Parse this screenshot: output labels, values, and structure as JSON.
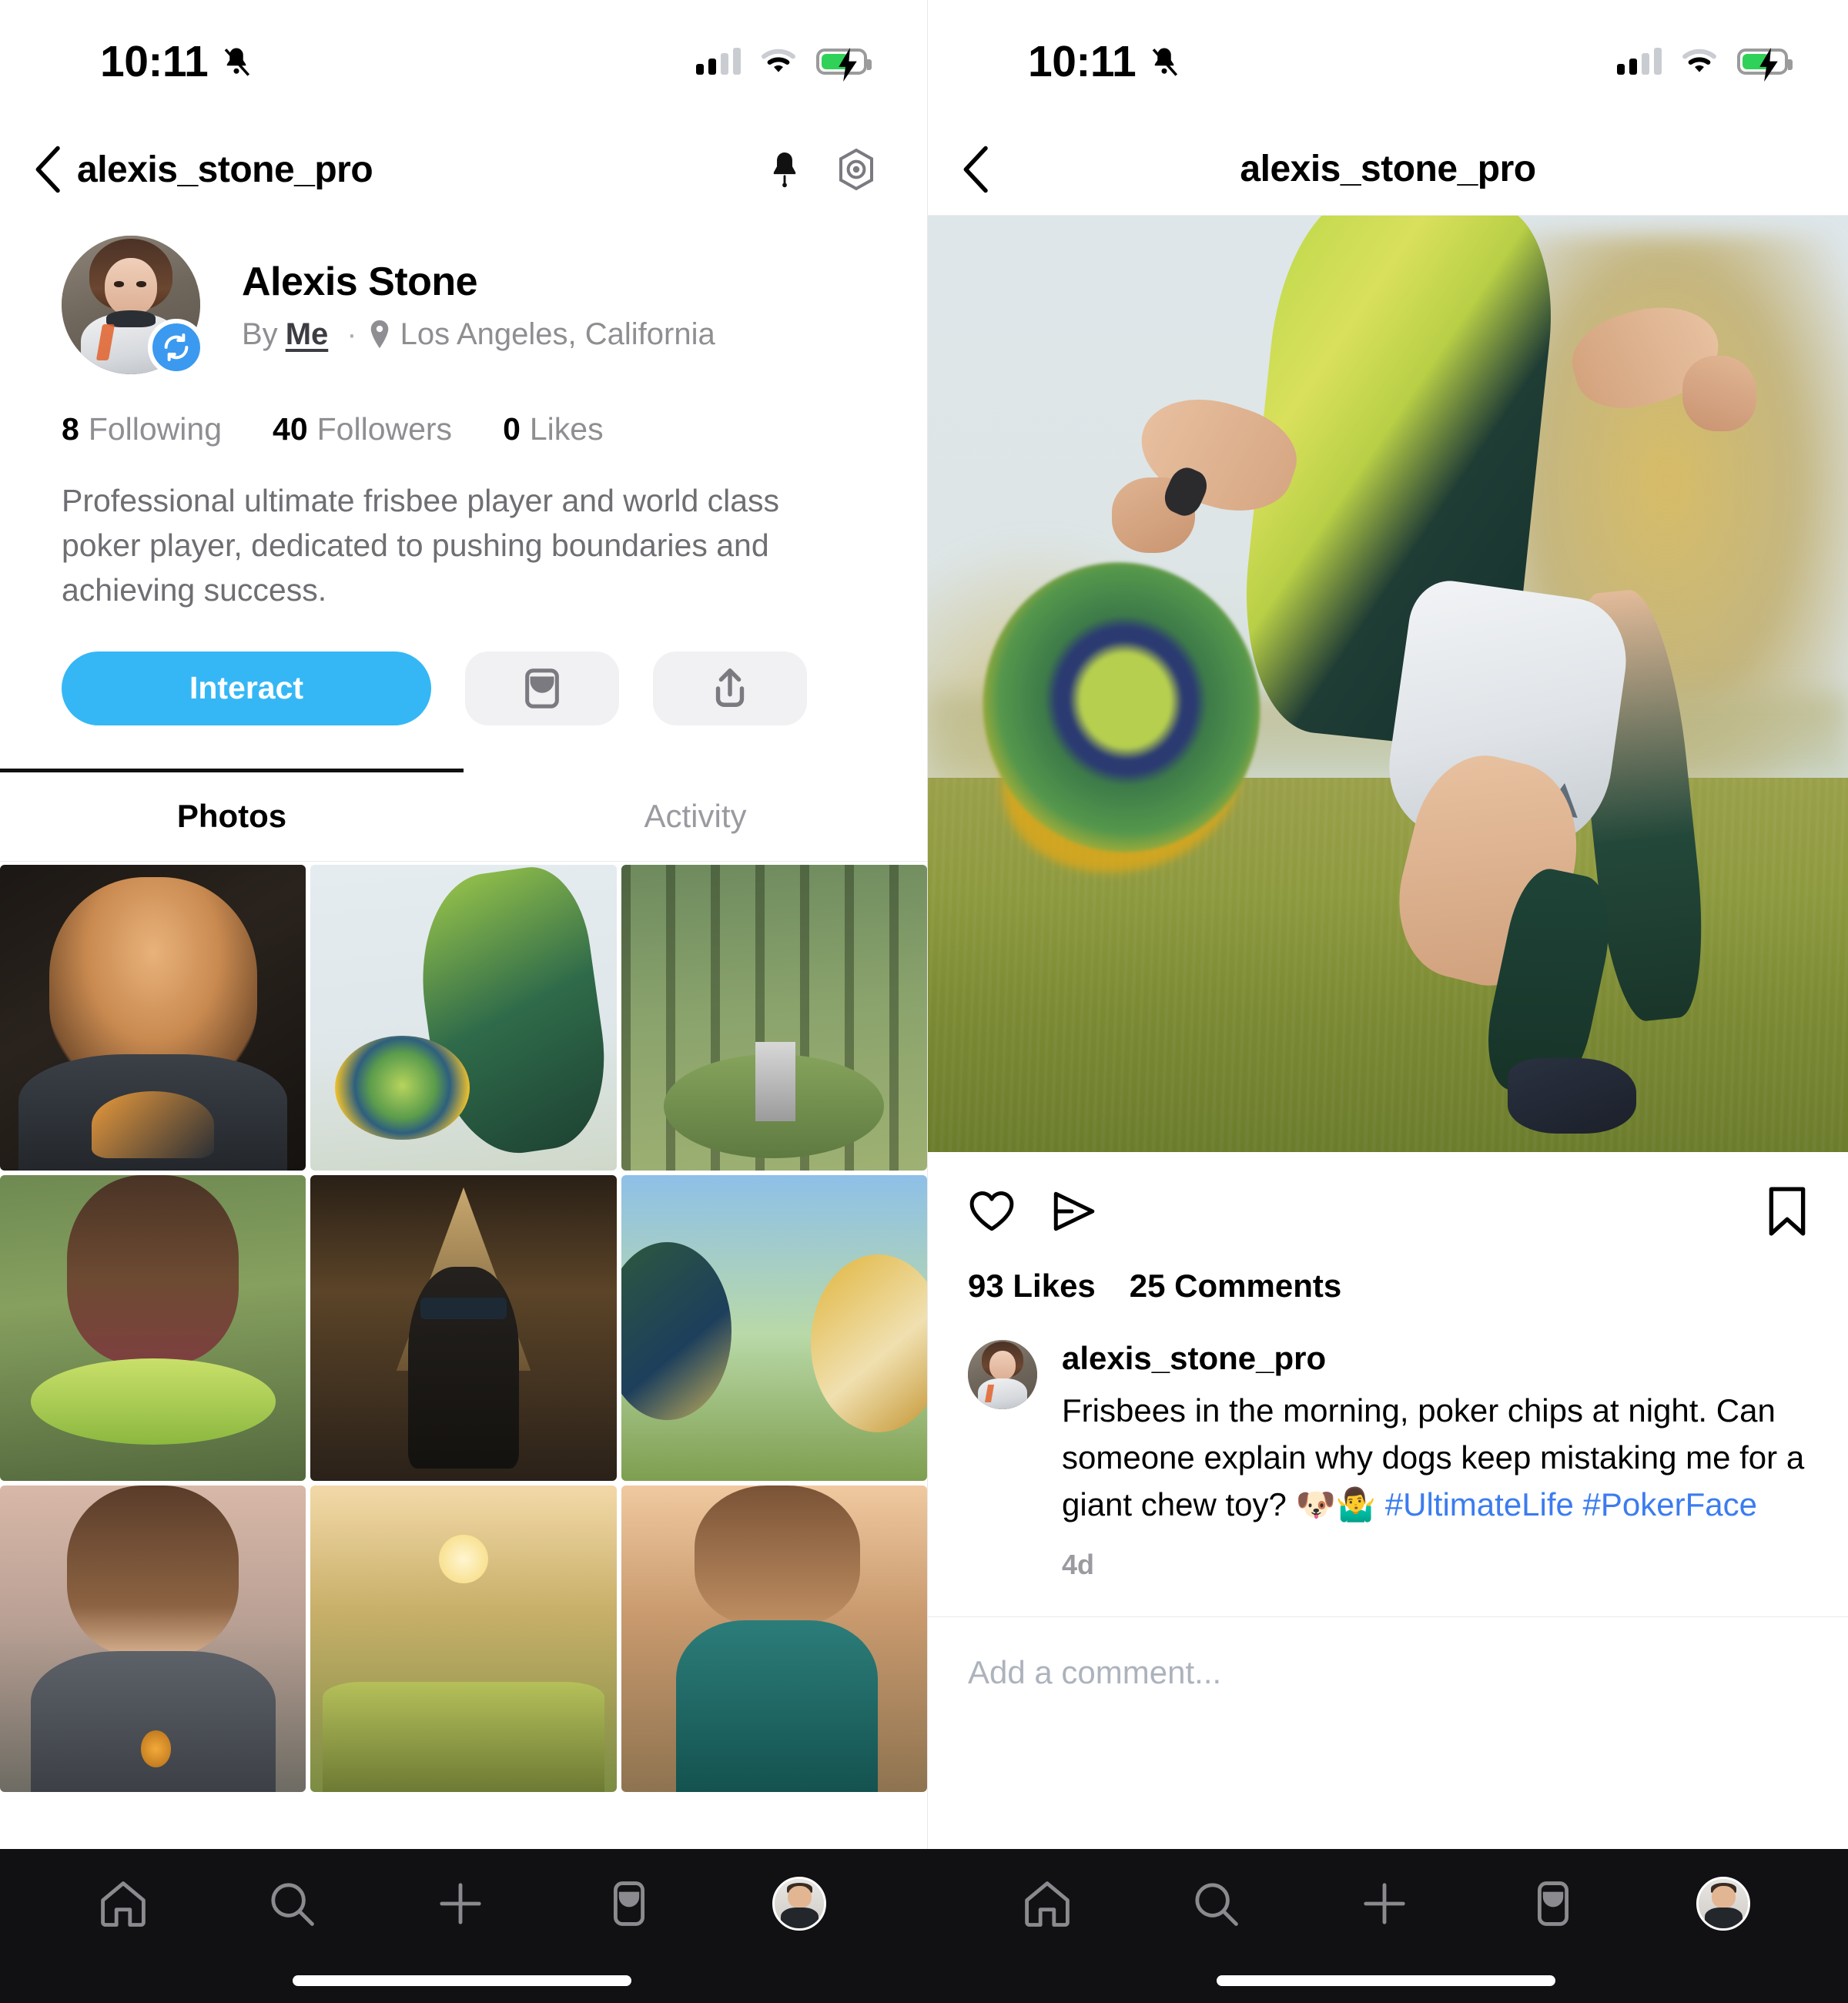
{
  "status_bar": {
    "time": "10:11",
    "icons": [
      "bell-mute-icon",
      "cellular-signal-icon",
      "wifi-icon",
      "battery-charging-icon"
    ],
    "signal_bars_active": 2,
    "signal_bars_total": 4,
    "battery_charging": true,
    "battery_color": "#30d158"
  },
  "left_pane": {
    "nav": {
      "back_icon": "chevron-left-icon",
      "title": "alexis_stone_pro",
      "bell_icon": "bell-icon",
      "badge_icon": "hexagon-target-icon"
    },
    "profile": {
      "display_name": "Alexis Stone",
      "by_label": "By",
      "by_value": "Me",
      "separator": "·",
      "location_icon": "location-pin-icon",
      "location": "Los Angeles, California",
      "avatar_badge_icon": "sync-refresh-icon",
      "avatar_badge_color": "#3b99f0",
      "stats": [
        {
          "value": "8",
          "label": "Following"
        },
        {
          "value": "40",
          "label": "Followers"
        },
        {
          "value": "0",
          "label": "Likes"
        }
      ],
      "bio": "Professional ultimate frisbee player and world class poker player, dedicated to pushing boundaries and achieving success."
    },
    "actions": {
      "interact_label": "Interact",
      "interact_color": "#35b7f5",
      "message_icon": "message-envelope-icon",
      "share_icon": "share-upload-icon"
    },
    "tabs": [
      {
        "label": "Photos",
        "active": true
      },
      {
        "label": "Activity",
        "active": false
      }
    ],
    "photo_grid": [
      {
        "name": "athlete-portrait-dark"
      },
      {
        "name": "frisbee-throw-action"
      },
      {
        "name": "forest-poker-table"
      },
      {
        "name": "frisbee-hold-park"
      },
      {
        "name": "hooded-sunglasses-portrait"
      },
      {
        "name": "giant-poker-chips-field"
      },
      {
        "name": "medal-portrait-dusk"
      },
      {
        "name": "sunset-poker-players"
      },
      {
        "name": "athlete-stretch-sunset"
      }
    ]
  },
  "right_pane": {
    "nav": {
      "back_icon": "chevron-left-icon",
      "title": "alexis_stone_pro"
    },
    "post": {
      "image_alt": "frisbee-player-throwing-disc",
      "like_icon": "heart-icon",
      "send_icon": "paper-plane-icon",
      "bookmark_icon": "bookmark-icon",
      "likes": "93 Likes",
      "comments": "25 Comments",
      "author": "alexis_stone_pro",
      "caption": "Frisbees in the morning, poker chips at night. Can someone explain why dogs keep mistaking me for a giant chew toy? 🐶🤷‍♂️",
      "hashtags": "#UltimateLife #PokerFace",
      "hashtag_color": "#3b7cf0",
      "timestamp": "4d",
      "comment_placeholder": "Add a comment..."
    }
  },
  "tab_bar": {
    "items": [
      {
        "icon": "home-icon"
      },
      {
        "icon": "search-icon"
      },
      {
        "icon": "plus-icon"
      },
      {
        "icon": "inbox-message-icon"
      },
      {
        "icon": "profile-avatar-icon"
      }
    ]
  }
}
